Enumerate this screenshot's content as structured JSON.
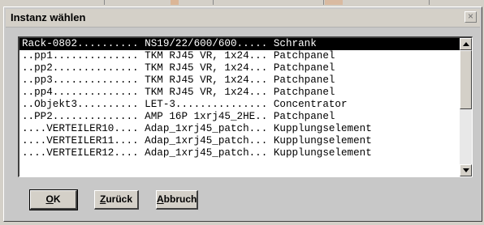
{
  "dialog": {
    "title": "Instanz wählen",
    "close_glyph": "×"
  },
  "list": {
    "rows": [
      "Rack-0802.......... NS19/22/600/600..... Schrank",
      "..pp1.............. TKM RJ45 VR, 1x24... Patchpanel",
      "..pp2.............. TKM RJ45 VR, 1x24... Patchpanel",
      "..pp3.............. TKM RJ45 VR, 1x24... Patchpanel",
      "..pp4.............. TKM RJ45 VR, 1x24... Patchpanel",
      "..Objekt3.......... LET-3............... Concentrator",
      "..PP2.............. AMP 16P 1xrj45_2HE.. Patchpanel",
      "....VERTEILER10.... Adap_1xrj45_patch... Kupplungselement",
      "....VERTEILER11.... Adap_1xrj45_patch... Kupplungselement",
      "....VERTEILER12.... Adap_1xrj45_patch... Kupplungselement"
    ],
    "selected_index": 0
  },
  "buttons": {
    "ok": {
      "mnemonic": "O",
      "rest": "K"
    },
    "back": {
      "mnemonic": "Z",
      "rest": "urück"
    },
    "cancel": {
      "mnemonic": "A",
      "rest": "bbruch"
    }
  }
}
